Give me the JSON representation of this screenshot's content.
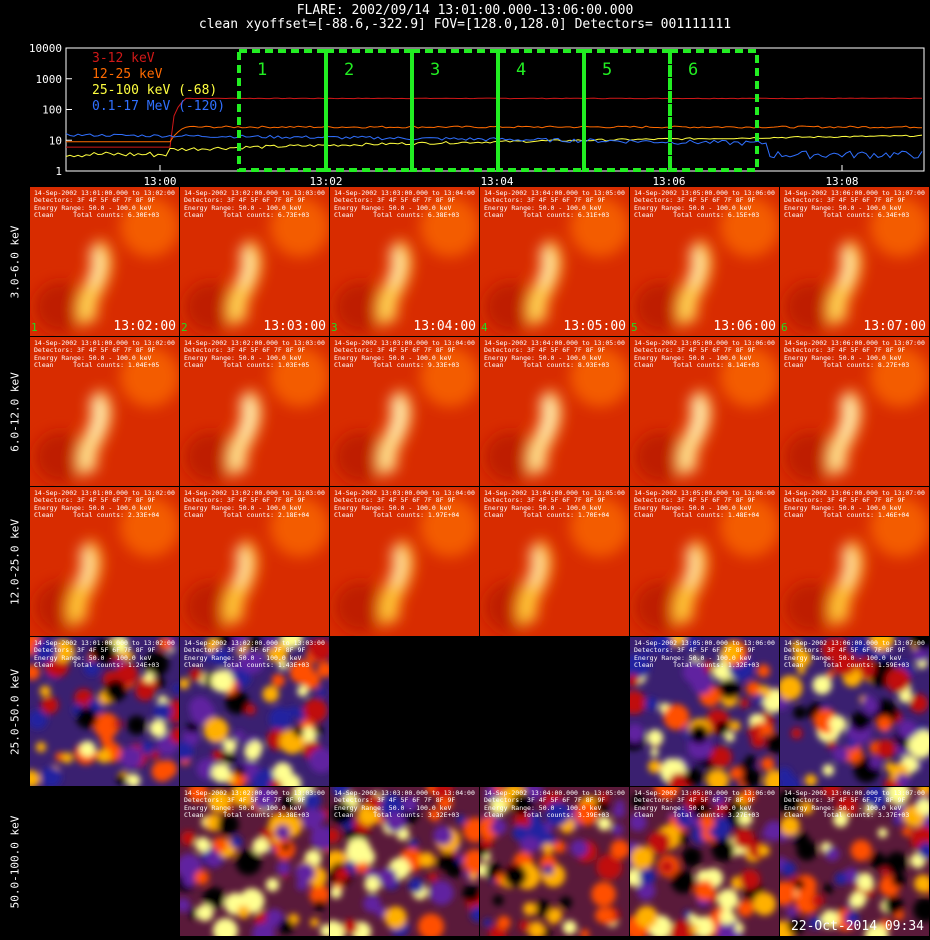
{
  "title": {
    "line1": "FLARE: 2002/09/14 13:01:00.000-13:06:00.000",
    "line2": "clean    xyoffset=[-88.6,-322.9]    FOV=[128.0,128.0]    Detectors= 001111111"
  },
  "lightcurve": {
    "yticks": [
      "10000",
      "1000",
      "100",
      "10",
      "1"
    ],
    "xticks": [
      "13:00",
      "13:02",
      "13:04",
      "13:06",
      "13:08"
    ],
    "legend": [
      {
        "label": "3-12 keV",
        "color": "#d01818"
      },
      {
        "label": "12-25 keV",
        "color": "#ff6a00"
      },
      {
        "label": "25-100 keV (-68)",
        "color": "#ffff40"
      },
      {
        "label": "0.1-17 MeV (-120)",
        "color": "#3070ff"
      }
    ],
    "intervals": [
      "1",
      "2",
      "3",
      "4",
      "5",
      "6"
    ],
    "interval_color": "#22ee22"
  },
  "row_labels": [
    "3.0-6.0 keV",
    "6.0-12.0 keV",
    "12.0-25.0 keV",
    "25.0-50.0 keV",
    "50.0-100.0 keV"
  ],
  "rows": [
    [
      {
        "h1": "14-Sep-2002 13:01:00.000 to 13:02:00",
        "counts": "6.30E+03",
        "stamp": "13:02:00",
        "idx": "1"
      },
      {
        "h1": "14-Sep-2002 13:02:00.000 to 13:03:00",
        "counts": "6.73E+03",
        "stamp": "13:03:00",
        "idx": "2"
      },
      {
        "h1": "14-Sep-2002 13:03:00.000 to 13:04:00",
        "counts": "6.38E+03",
        "stamp": "13:04:00",
        "idx": "3"
      },
      {
        "h1": "14-Sep-2002 13:04:00.000 to 13:05:00",
        "counts": "6.31E+03",
        "stamp": "13:05:00",
        "idx": "4"
      },
      {
        "h1": "14-Sep-2002 13:05:00.000 to 13:06:00",
        "counts": "6.15E+03",
        "stamp": "13:06:00",
        "idx": "5"
      },
      {
        "h1": "14-Sep-2002 13:06:00.000 to 13:07:00",
        "counts": "6.34E+03",
        "stamp": "13:07:00",
        "idx": "6"
      }
    ],
    [
      {
        "h1": "14-Sep-2002 13:01:00.000 to 13:02:00",
        "counts": "1.04E+05"
      },
      {
        "h1": "14-Sep-2002 13:02:00.000 to 13:03:00",
        "counts": "1.03E+05"
      },
      {
        "h1": "14-Sep-2002 13:03:00.000 to 13:04:00",
        "counts": "9.33E+03"
      },
      {
        "h1": "14-Sep-2002 13:04:00.000 to 13:05:00",
        "counts": "8.93E+03"
      },
      {
        "h1": "14-Sep-2002 13:05:00.000 to 13:06:00",
        "counts": "8.14E+03"
      },
      {
        "h1": "14-Sep-2002 13:06:00.000 to 13:07:00",
        "counts": "8.27E+03"
      }
    ],
    [
      {
        "h1": "14-Sep-2002 13:01:00.000 to 13:02:00",
        "counts": "2.33E+04"
      },
      {
        "h1": "14-Sep-2002 13:02:00.000 to 13:03:00",
        "counts": "2.18E+04"
      },
      {
        "h1": "14-Sep-2002 13:03:00.000 to 13:04:00",
        "counts": "1.97E+04"
      },
      {
        "h1": "14-Sep-2002 13:04:00.000 to 13:05:00",
        "counts": "1.70E+04"
      },
      {
        "h1": "14-Sep-2002 13:05:00.000 to 13:06:00",
        "counts": "1.48E+04"
      },
      {
        "h1": "14-Sep-2002 13:06:00.000 to 13:07:00",
        "counts": "1.46E+04"
      }
    ],
    [
      {
        "h1": "14-Sep-2002 13:01:00.000 to 13:02:00",
        "counts": "1.24E+03"
      },
      {
        "h1": "14-Sep-2002 13:02:00.000 to 13:03:00",
        "counts": "1.43E+03"
      },
      null,
      null,
      {
        "h1": "14-Sep-2002 13:05:00.000 to 13:06:00",
        "counts": "1.32E+03"
      },
      {
        "h1": "14-Sep-2002 13:06:00.000 to 13:07:00",
        "counts": "1.59E+03"
      }
    ],
    [
      null,
      {
        "h1": "14-Sep-2002 13:02:00.000 to 13:03:00",
        "counts": "3.38E+03"
      },
      {
        "h1": "14-Sep-2002 13:03:00.000 to 13:04:00",
        "counts": "3.32E+03"
      },
      {
        "h1": "14-Sep-2002 13:04:00.000 to 13:05:00",
        "counts": "3.39E+03"
      },
      {
        "h1": "14-Sep-2002 13:05:00.000 to 13:06:00",
        "counts": "3.27E+03"
      },
      {
        "h1": "14-Sep-2002 13:06:00.000 to 13:07:00",
        "counts": "3.37E+03"
      }
    ]
  ],
  "header_lines": {
    "detectors": "Detectors: 3F 4F 5F 6F 7F 8F 9F",
    "energy": "Energy Range: 50.0 - 100.0 keV",
    "clean_prefix": "Clean     Total counts: "
  },
  "footer_date": "22-Oct-2014 09:34"
}
